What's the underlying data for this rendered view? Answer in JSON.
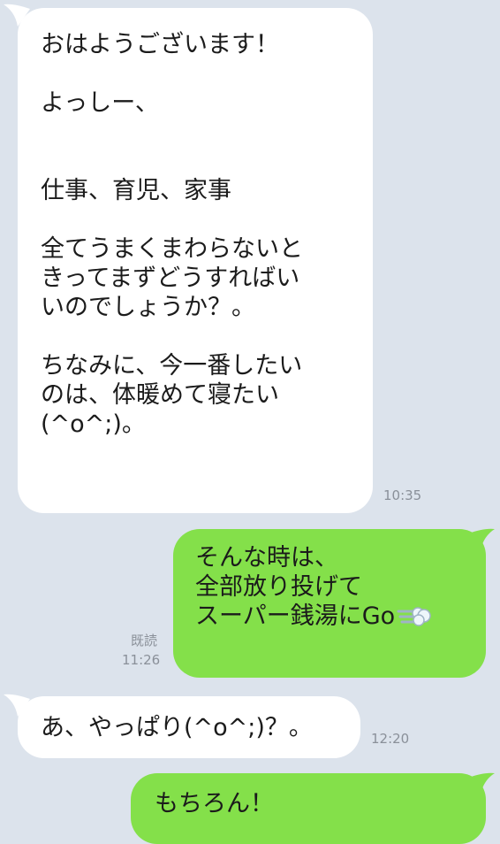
{
  "messages": [
    {
      "side": "incoming",
      "text": "おはようございます！\n\nよっしー、\n\n\n仕事、育児、家事\n\n全てうまくまわらないと\nきってまずどうすればい\nいのでしょうか？。\n\nちなみに、今一番したい\nのは、体暖めて寝たい\n(^o^;)。",
      "time": "10:35"
    },
    {
      "side": "outgoing",
      "text": "そんな時は、\n全部放り投げて\nスーパー銭湯にGo",
      "emoji": "dash-icon",
      "read": "既読",
      "time": "11:26"
    },
    {
      "side": "incoming",
      "text": "あ、やっぱり(^o^;)？。",
      "time": "12:20"
    },
    {
      "side": "outgoing",
      "text": "もちろん！"
    }
  ],
  "colors": {
    "background": "#dce3ec",
    "incoming_bubble": "#ffffff",
    "outgoing_bubble": "#84e04a",
    "meta_text": "#8a9099"
  }
}
